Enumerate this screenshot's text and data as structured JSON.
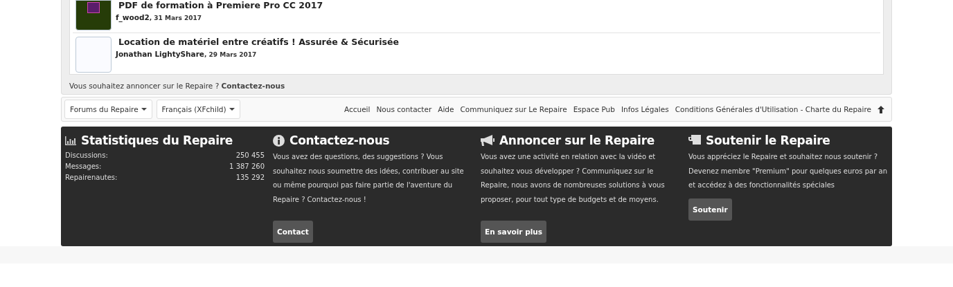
{
  "threads": [
    {
      "title": "PDF de formation à Premiere Pro CC 2017",
      "author": "f_wood2",
      "date": ", 31 Mars 2017"
    },
    {
      "title": "Location de matériel entre créatifs ! Assurée & Sécurisée",
      "author": "Jonathan LightyShare",
      "date": ", 29 Mars 2017"
    }
  ],
  "advert": {
    "text": "Vous souhaitez annoncer sur le Repaire ?",
    "link": "Contactez-nous"
  },
  "selectors": [
    {
      "label": "Forums du Repaire"
    },
    {
      "label": "Français (XFchild)"
    }
  ],
  "footer_links": [
    "Accueil",
    "Nous contacter",
    "Aide",
    "Communiquez sur Le Repaire",
    "Espace Pub",
    "Infos Légales",
    "Conditions Générales d'Utilisation - Charte du Repaire"
  ],
  "blocks": [
    {
      "kind": "stats",
      "title": "Statistiques du Repaire",
      "stats": [
        {
          "label": "Discussions:",
          "value": "250 455"
        },
        {
          "label": "Messages:",
          "value": "1 387 260"
        },
        {
          "label": "Repairenautes:",
          "value": "135 292"
        }
      ]
    },
    {
      "kind": "text",
      "title": "Contactez-nous",
      "text": "Vous avez des questions, des suggestions ? Vous souhaitez nous soumettre des idées, contribuer au site ou même pourquoi pas faire partie de l'aventure du Repaire ? Contactez-nous !",
      "button": "Contact"
    },
    {
      "kind": "text",
      "title": "Annoncer sur le Repaire",
      "text": "Vous avez une activité en relation avec la vidéo et souhaitez vous développer ? Communiquez sur le Repaire, nous avons de nombreuses solutions à vous proposer, pour tout type de budgets et de moyens.",
      "button": "En savoir plus"
    },
    {
      "kind": "text",
      "title": "Soutenir le Repaire",
      "text": "Vous appréciez le Repaire et souhaitez nous soutenir ? Devenez membre \"Premium\" pour quelques euros par an et accédez à des fonctionnalités spéciales",
      "button": "Soutenir"
    }
  ]
}
